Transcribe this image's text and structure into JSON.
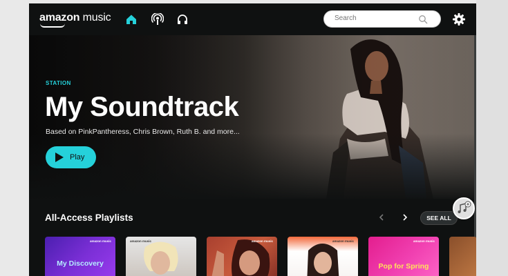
{
  "app": {
    "logo_prefix": "amazon",
    "logo_suffix": "music"
  },
  "nav": {
    "home_icon": "home-icon",
    "podcasts_icon": "podcast-icon",
    "library_icon": "headphones-icon",
    "search_placeholder": "Search",
    "settings_icon": "gear-icon",
    "accent_color": "#25d1da"
  },
  "hero": {
    "eyebrow": "STATION",
    "title": "My Soundtrack",
    "subtitle": "Based on PinkPantheress, Chris Brown, Ruth B. and more...",
    "play_label": "Play"
  },
  "section": {
    "title": "All-Access Playlists",
    "see_all_label": "SEE ALL",
    "cards": [
      {
        "title": "My Discovery",
        "brand": "amazon music"
      },
      {
        "title": "",
        "brand": "amazon music"
      },
      {
        "title": "",
        "brand": "amazon music"
      },
      {
        "title": "",
        "brand": "amazon music"
      },
      {
        "title": "",
        "brand": "amazon music"
      },
      {
        "title": "Pop for Spring",
        "brand": "amazon music"
      },
      {
        "title": "",
        "brand": ""
      }
    ]
  }
}
